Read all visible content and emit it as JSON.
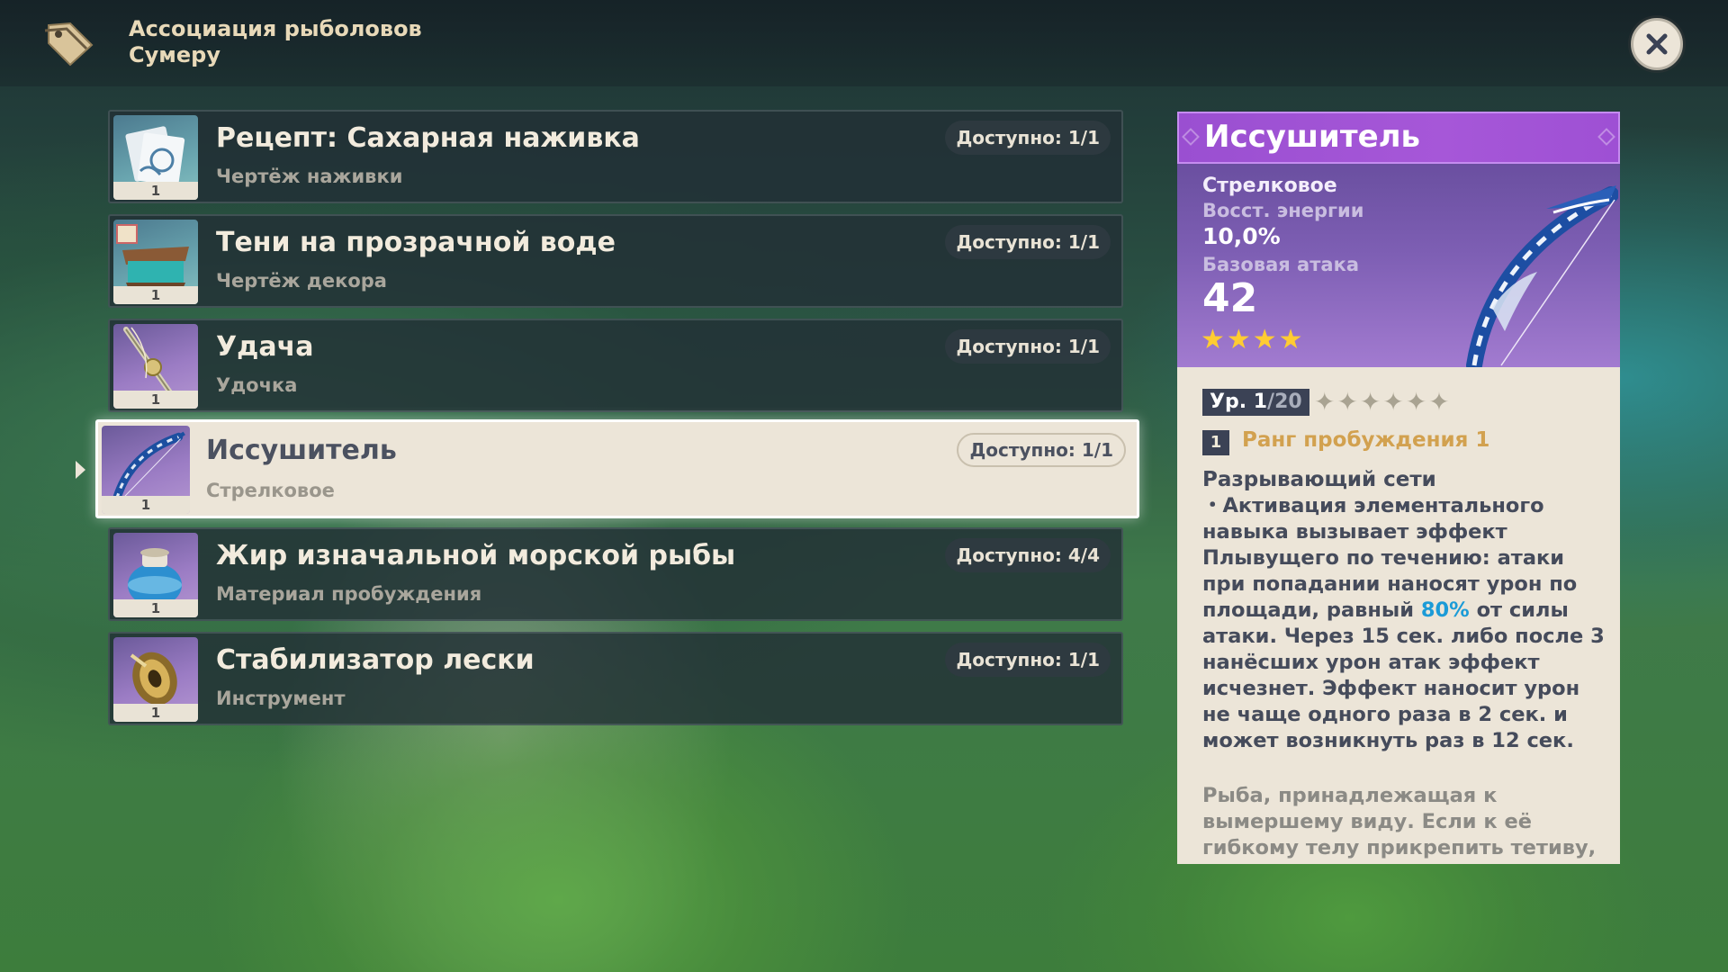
{
  "header": {
    "title_line1": "Ассоциация рыболовов",
    "title_line2": "Сумеру",
    "icon": "tag-icon",
    "close_icon": "close-icon"
  },
  "items": [
    {
      "title": "Рецепт: Сахарная наживка",
      "subtitle": "Чертёж наживки",
      "available": "Доступно: 1/1",
      "count": "1",
      "icon": "blueprint-icon",
      "selected": false
    },
    {
      "title": "Тени на прозрачной воде",
      "subtitle": "Чертёж декора",
      "available": "Доступно: 1/1",
      "count": "1",
      "icon": "furnishing-icon",
      "selected": false
    },
    {
      "title": "Удача",
      "subtitle": "Удочка",
      "available": "Доступно: 1/1",
      "count": "1",
      "icon": "fishing-rod-icon",
      "selected": false
    },
    {
      "title": "Иссушитель",
      "subtitle": "Стрелковое",
      "available": "Доступно: 1/1",
      "count": "1",
      "icon": "bow-icon",
      "selected": true
    },
    {
      "title": "Жир изначальной морской рыбы",
      "subtitle": "Материал пробуждения",
      "available": "Доступно: 4/4",
      "count": "1",
      "icon": "jar-icon",
      "selected": false
    },
    {
      "title": "Стабилизатор лески",
      "subtitle": "Инструмент",
      "available": "Доступно: 1/1",
      "count": "1",
      "icon": "reel-icon",
      "selected": false
    }
  ],
  "detail": {
    "name": "Иссушитель",
    "weapon_type": "Стрелковое",
    "secondary_stat_label": "Восст. энергии",
    "secondary_stat_value": "10,0%",
    "base_atk_label": "Базовая атака",
    "base_atk_value": "42",
    "rarity": 4,
    "rarity_stars": "★★★★",
    "level_prefix": "Ур. 1",
    "level_max": "/20",
    "ascension_stars": "✦✦✦✦✦✦",
    "refinement_num": "1",
    "refinement_text": "Ранг пробуждения 1",
    "passive_name": "Разрывающий сети",
    "passive_pre": "・Активация элементального навыка вызывает эффект Плывущего по течению: атаки при попадании наносят урон по площади, равный ",
    "passive_highlight": "80%",
    "passive_post": " от силы атаки. Через 15 сек. либо после 3 нанёсших урон атак эффект исчезнет. Эффект наносит урон не чаще одного раза в 2 сек. и может возникнуть раз в 12 сек.",
    "lore": "Рыба, принадлежащая к вымершему виду. Если к её гибкому телу прикрепить тетиву, она может послужить в качестве"
  },
  "colors": {
    "rarity4_header": "#a657d8",
    "highlight": "#1b9bd7",
    "refinement": "#d2a14f",
    "panel_bg": "#ece5d8"
  }
}
